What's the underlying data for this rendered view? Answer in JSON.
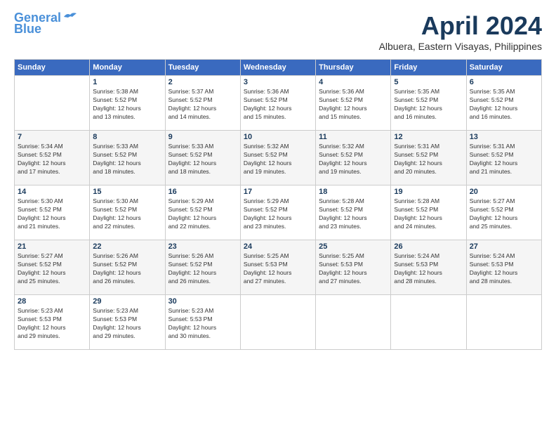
{
  "logo": {
    "line1": "General",
    "line2": "Blue"
  },
  "title": "April 2024",
  "subtitle": "Albuera, Eastern Visayas, Philippines",
  "weekdays": [
    "Sunday",
    "Monday",
    "Tuesday",
    "Wednesday",
    "Thursday",
    "Friday",
    "Saturday"
  ],
  "weeks": [
    [
      {
        "day": "",
        "info": ""
      },
      {
        "day": "1",
        "info": "Sunrise: 5:38 AM\nSunset: 5:52 PM\nDaylight: 12 hours\nand 13 minutes."
      },
      {
        "day": "2",
        "info": "Sunrise: 5:37 AM\nSunset: 5:52 PM\nDaylight: 12 hours\nand 14 minutes."
      },
      {
        "day": "3",
        "info": "Sunrise: 5:36 AM\nSunset: 5:52 PM\nDaylight: 12 hours\nand 15 minutes."
      },
      {
        "day": "4",
        "info": "Sunrise: 5:36 AM\nSunset: 5:52 PM\nDaylight: 12 hours\nand 15 minutes."
      },
      {
        "day": "5",
        "info": "Sunrise: 5:35 AM\nSunset: 5:52 PM\nDaylight: 12 hours\nand 16 minutes."
      },
      {
        "day": "6",
        "info": "Sunrise: 5:35 AM\nSunset: 5:52 PM\nDaylight: 12 hours\nand 16 minutes."
      }
    ],
    [
      {
        "day": "7",
        "info": "Sunrise: 5:34 AM\nSunset: 5:52 PM\nDaylight: 12 hours\nand 17 minutes."
      },
      {
        "day": "8",
        "info": "Sunrise: 5:33 AM\nSunset: 5:52 PM\nDaylight: 12 hours\nand 18 minutes."
      },
      {
        "day": "9",
        "info": "Sunrise: 5:33 AM\nSunset: 5:52 PM\nDaylight: 12 hours\nand 18 minutes."
      },
      {
        "day": "10",
        "info": "Sunrise: 5:32 AM\nSunset: 5:52 PM\nDaylight: 12 hours\nand 19 minutes."
      },
      {
        "day": "11",
        "info": "Sunrise: 5:32 AM\nSunset: 5:52 PM\nDaylight: 12 hours\nand 19 minutes."
      },
      {
        "day": "12",
        "info": "Sunrise: 5:31 AM\nSunset: 5:52 PM\nDaylight: 12 hours\nand 20 minutes."
      },
      {
        "day": "13",
        "info": "Sunrise: 5:31 AM\nSunset: 5:52 PM\nDaylight: 12 hours\nand 21 minutes."
      }
    ],
    [
      {
        "day": "14",
        "info": "Sunrise: 5:30 AM\nSunset: 5:52 PM\nDaylight: 12 hours\nand 21 minutes."
      },
      {
        "day": "15",
        "info": "Sunrise: 5:30 AM\nSunset: 5:52 PM\nDaylight: 12 hours\nand 22 minutes."
      },
      {
        "day": "16",
        "info": "Sunrise: 5:29 AM\nSunset: 5:52 PM\nDaylight: 12 hours\nand 22 minutes."
      },
      {
        "day": "17",
        "info": "Sunrise: 5:29 AM\nSunset: 5:52 PM\nDaylight: 12 hours\nand 23 minutes."
      },
      {
        "day": "18",
        "info": "Sunrise: 5:28 AM\nSunset: 5:52 PM\nDaylight: 12 hours\nand 23 minutes."
      },
      {
        "day": "19",
        "info": "Sunrise: 5:28 AM\nSunset: 5:52 PM\nDaylight: 12 hours\nand 24 minutes."
      },
      {
        "day": "20",
        "info": "Sunrise: 5:27 AM\nSunset: 5:52 PM\nDaylight: 12 hours\nand 25 minutes."
      }
    ],
    [
      {
        "day": "21",
        "info": "Sunrise: 5:27 AM\nSunset: 5:52 PM\nDaylight: 12 hours\nand 25 minutes."
      },
      {
        "day": "22",
        "info": "Sunrise: 5:26 AM\nSunset: 5:52 PM\nDaylight: 12 hours\nand 26 minutes."
      },
      {
        "day": "23",
        "info": "Sunrise: 5:26 AM\nSunset: 5:52 PM\nDaylight: 12 hours\nand 26 minutes."
      },
      {
        "day": "24",
        "info": "Sunrise: 5:25 AM\nSunset: 5:53 PM\nDaylight: 12 hours\nand 27 minutes."
      },
      {
        "day": "25",
        "info": "Sunrise: 5:25 AM\nSunset: 5:53 PM\nDaylight: 12 hours\nand 27 minutes."
      },
      {
        "day": "26",
        "info": "Sunrise: 5:24 AM\nSunset: 5:53 PM\nDaylight: 12 hours\nand 28 minutes."
      },
      {
        "day": "27",
        "info": "Sunrise: 5:24 AM\nSunset: 5:53 PM\nDaylight: 12 hours\nand 28 minutes."
      }
    ],
    [
      {
        "day": "28",
        "info": "Sunrise: 5:23 AM\nSunset: 5:53 PM\nDaylight: 12 hours\nand 29 minutes."
      },
      {
        "day": "29",
        "info": "Sunrise: 5:23 AM\nSunset: 5:53 PM\nDaylight: 12 hours\nand 29 minutes."
      },
      {
        "day": "30",
        "info": "Sunrise: 5:23 AM\nSunset: 5:53 PM\nDaylight: 12 hours\nand 30 minutes."
      },
      {
        "day": "",
        "info": ""
      },
      {
        "day": "",
        "info": ""
      },
      {
        "day": "",
        "info": ""
      },
      {
        "day": "",
        "info": ""
      }
    ]
  ]
}
